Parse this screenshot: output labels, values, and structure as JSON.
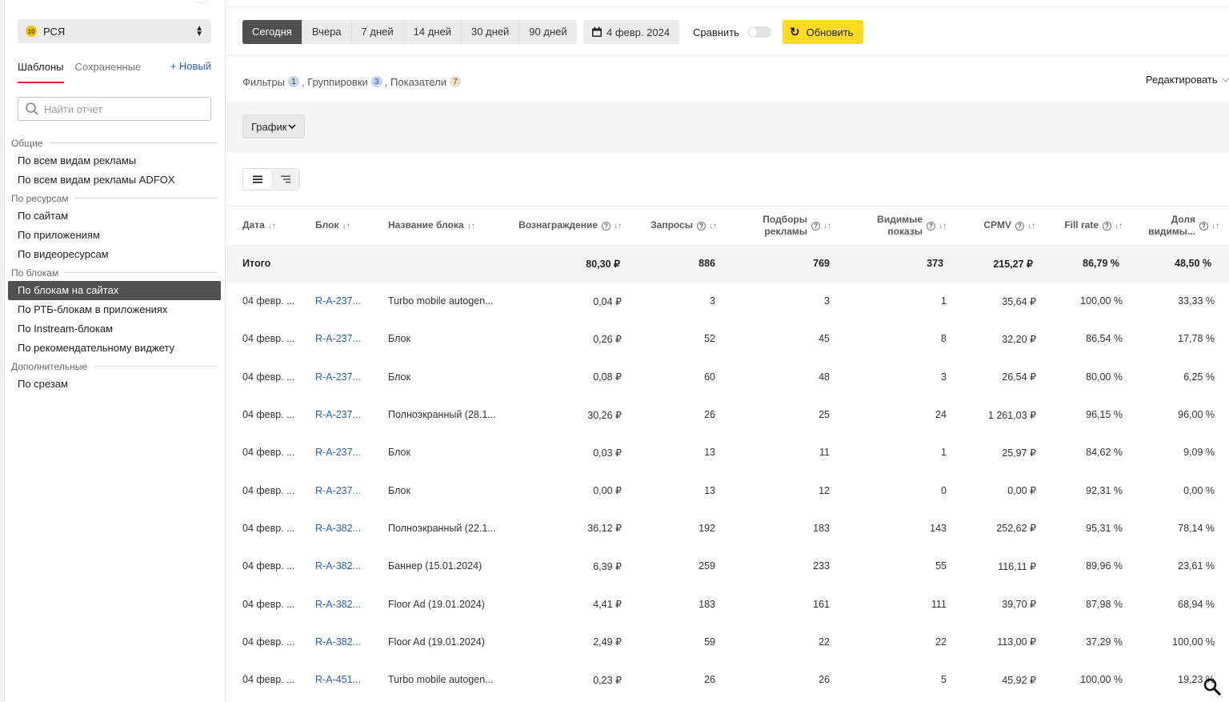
{
  "sidebar": {
    "product": {
      "name": "РСЯ",
      "coin": "10"
    },
    "tabs": [
      "Шаблоны",
      "Сохраненные"
    ],
    "new_link": "+ Новый",
    "search_placeholder": "Найти отчет",
    "groups": [
      {
        "label": "Общие",
        "items": [
          "По всем видам рекламы",
          "По всем видам рекламы ADFOX"
        ]
      },
      {
        "label": "По ресурсам",
        "items": [
          "По сайтам",
          "По приложениям",
          "По видеоресурсам"
        ]
      },
      {
        "label": "По блокам",
        "items": [
          "По блокам на сайтах",
          "По РТБ-блокам в приложениях",
          "По Instream-блокам",
          "По рекомендательному виджету"
        ]
      },
      {
        "label": "Дополнительные",
        "items": [
          "По срезам"
        ]
      }
    ],
    "selected_item": "По блокам на сайтах"
  },
  "toolbar": {
    "periods": [
      "Сегодня",
      "Вчера",
      "7 дней",
      "14 дней",
      "30 дней",
      "90 дней"
    ],
    "active_period": "Сегодня",
    "date": "4 февр. 2024",
    "compare_label": "Сравнить",
    "compare_on": false,
    "refresh_label": "Обновить"
  },
  "filters": {
    "filters_label": "Фильтры",
    "filters_count": "1",
    "groupings_label": ", Группировки",
    "groupings_count": "3",
    "metrics_label": ", Показатели",
    "metrics_count": "7",
    "edit_label": "Редактировать"
  },
  "chart": {
    "button_label": "График"
  },
  "table": {
    "headers": {
      "date": "Дата",
      "block": "Блок",
      "block_name": "Название блока",
      "reward": "Вознаграждение",
      "requests": "Запросы",
      "ad_picks_1": "Подборы",
      "ad_picks_2": "рекламы",
      "visible_1": "Видимые",
      "visible_2": "показы",
      "cpmv": "CPMV",
      "fill_rate": "Fill rate",
      "share_1": "Доля",
      "share_2": "видимы..."
    },
    "total": {
      "label": "Итого",
      "reward": "80,30 ₽",
      "requests": "886",
      "ad_picks": "769",
      "visible": "373",
      "cpmv": "215,27 ₽",
      "fill_rate": "86,79 %",
      "share": "48,50 %"
    },
    "rows": [
      [
        "04 февр. ...",
        "R-A-237...",
        "Turbo mobile autogen...",
        "0,04 ₽",
        "3",
        "3",
        "1",
        "35,64 ₽",
        "100,00 %",
        "33,33 %"
      ],
      [
        "04 февр. ...",
        "R-A-237...",
        "Блок",
        "0,26 ₽",
        "52",
        "45",
        "8",
        "32,20 ₽",
        "86,54 %",
        "17,78 %"
      ],
      [
        "04 февр. ...",
        "R-A-237...",
        "Блок",
        "0,08 ₽",
        "60",
        "48",
        "3",
        "26,54 ₽",
        "80,00 %",
        "6,25 %"
      ],
      [
        "04 февр. ...",
        "R-A-237...",
        "Полноэкранный (28.1...",
        "30,26 ₽",
        "26",
        "25",
        "24",
        "1 261,03 ₽",
        "96,15 %",
        "96,00 %"
      ],
      [
        "04 февр. ...",
        "R-A-237...",
        "Блок",
        "0,03 ₽",
        "13",
        "11",
        "1",
        "25,97 ₽",
        "84,62 %",
        "9,09 %"
      ],
      [
        "04 февр. ...",
        "R-A-237...",
        "Блок",
        "0,00 ₽",
        "13",
        "12",
        "0",
        "0,00 ₽",
        "92,31 %",
        "0,00 %"
      ],
      [
        "04 февр. ...",
        "R-A-382...",
        "Полноэкранный (22.1...",
        "36,12 ₽",
        "192",
        "183",
        "143",
        "252,62 ₽",
        "95,31 %",
        "78,14 %"
      ],
      [
        "04 февр. ...",
        "R-A-382...",
        "Баннер (15.01.2024)",
        "6,39 ₽",
        "259",
        "233",
        "55",
        "116,11 ₽",
        "89,96 %",
        "23,61 %"
      ],
      [
        "04 февр. ...",
        "R-A-382...",
        "Floor Ad (19.01.2024)",
        "4,41 ₽",
        "183",
        "161",
        "111",
        "39,70 ₽",
        "87,98 %",
        "68,94 %"
      ],
      [
        "04 февр. ...",
        "R-A-382...",
        "Floor Ad (19.01.2024)",
        "2,49 ₽",
        "59",
        "22",
        "22",
        "113,00 ₽",
        "37,29 %",
        "100,00 %"
      ],
      [
        "04 февр. ...",
        "R-A-451...",
        "Turbo mobile autogen...",
        "0,23 ₽",
        "26",
        "26",
        "5",
        "45,92 ₽",
        "100,00 %",
        "19,23 %"
      ]
    ]
  },
  "colors": {
    "accent_yellow": "#ffdb1f",
    "link_blue": "#2a5dc0",
    "tab_underline": "#ee2222",
    "selected_bg": "#505050"
  }
}
